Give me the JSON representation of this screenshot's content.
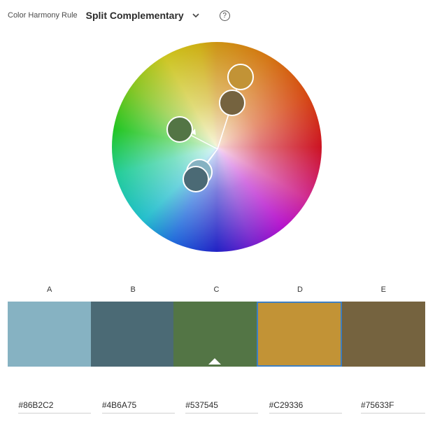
{
  "header": {
    "rule_label": "Color Harmony Rule",
    "rule_value": "Split Complementary",
    "help_symbol": "?"
  },
  "swatches": [
    {
      "letter": "A",
      "hex": "#86B2C2",
      "color": "#86B2C2",
      "selected": false,
      "base": false
    },
    {
      "letter": "B",
      "hex": "#4B6A75",
      "color": "#4B6A75",
      "selected": false,
      "base": false
    },
    {
      "letter": "C",
      "hex": "#537545",
      "color": "#537545",
      "selected": false,
      "base": true
    },
    {
      "letter": "D",
      "hex": "#C29336",
      "color": "#C29336",
      "selected": true,
      "base": false
    },
    {
      "letter": "E",
      "hex": "#75633F",
      "color": "#75633F",
      "selected": false,
      "base": false
    }
  ],
  "icons": {
    "chevron": "chevron-down-icon",
    "help": "help-circle-icon",
    "base_marker": "triangle-up-icon"
  },
  "colors": {
    "selection_border": "#3d7fc2",
    "handle_ring": "#ffffff"
  }
}
